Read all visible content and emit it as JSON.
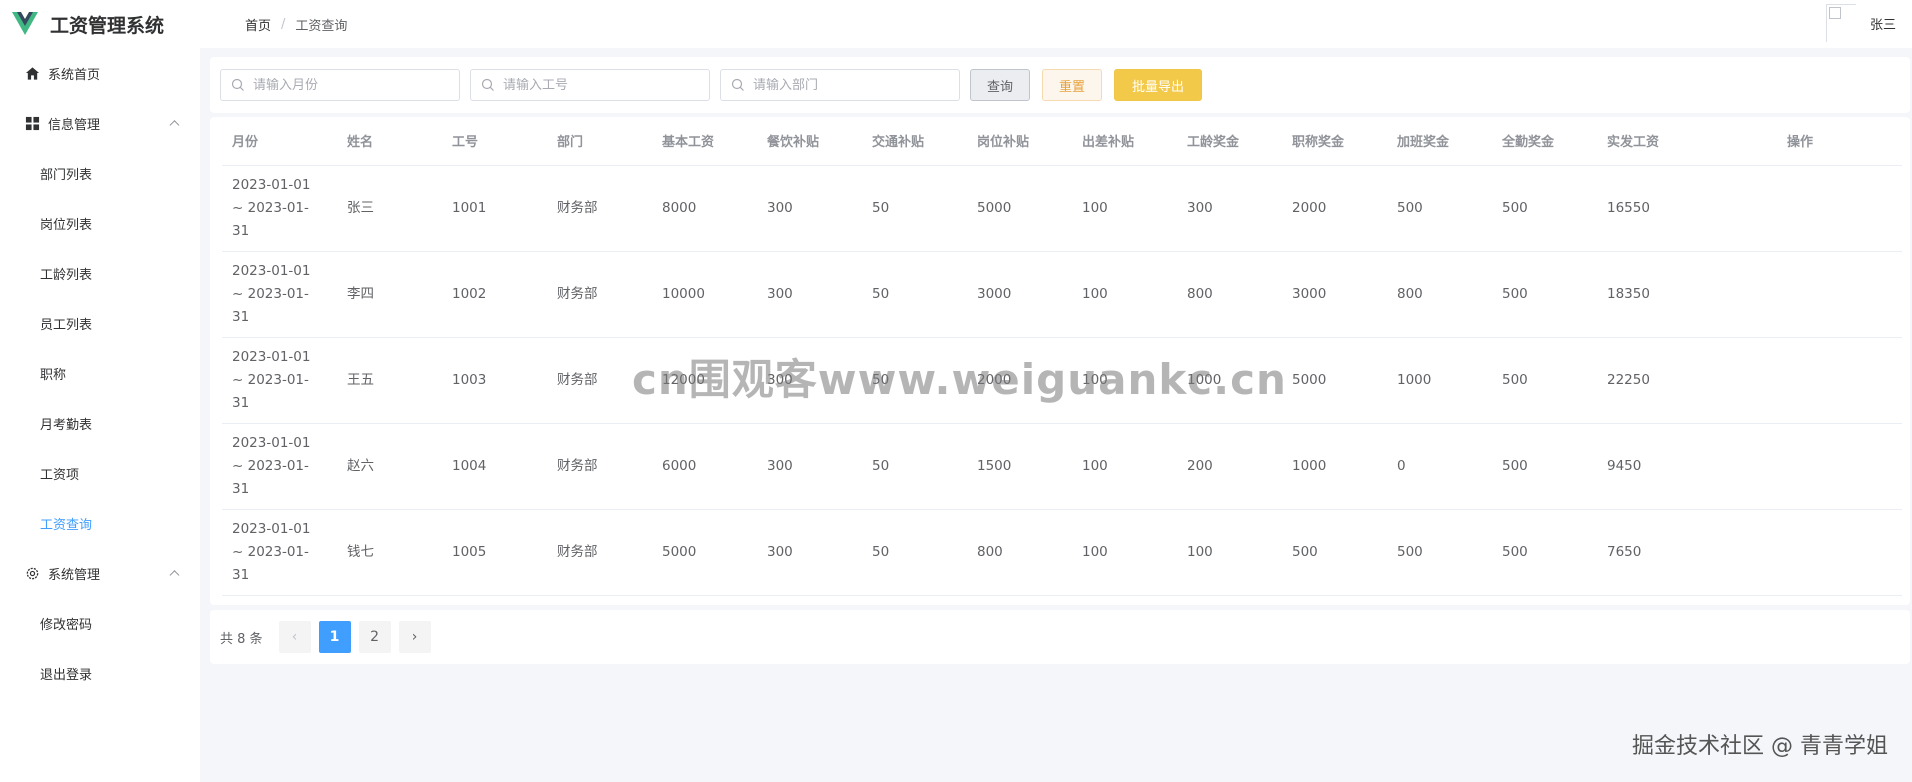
{
  "app": {
    "title": "工资管理系统",
    "brand_color": "#41b883"
  },
  "breadcrumb": {
    "home": "首页",
    "separator": "/",
    "current": "工资查询"
  },
  "user": {
    "name": "张三"
  },
  "sidebar": {
    "items": [
      {
        "label": "系统首页",
        "icon": "home-icon"
      },
      {
        "label": "信息管理",
        "icon": "grid-icon",
        "expanded": true
      },
      {
        "label": "部门列表"
      },
      {
        "label": "岗位列表"
      },
      {
        "label": "工龄列表"
      },
      {
        "label": "员工列表"
      },
      {
        "label": "职称"
      },
      {
        "label": "月考勤表"
      },
      {
        "label": "工资项"
      },
      {
        "label": "工资查询",
        "active": true
      },
      {
        "label": "系统管理",
        "icon": "gear-icon",
        "expanded": true
      },
      {
        "label": "修改密码"
      },
      {
        "label": "退出登录"
      }
    ]
  },
  "search": {
    "month_placeholder": "请输入月份",
    "id_placeholder": "请输入工号",
    "dept_placeholder": "请输入部门",
    "query_label": "查询",
    "reset_label": "重置",
    "export_label": "批量导出"
  },
  "table": {
    "headers": [
      "月份",
      "姓名",
      "工号",
      "部门",
      "基本工资",
      "餐饮补贴",
      "交通补贴",
      "岗位补贴",
      "出差补贴",
      "工龄奖金",
      "职称奖金",
      "加班奖金",
      "全勤奖金",
      "实发工资",
      "操作"
    ],
    "rows": [
      {
        "month": "2023-01-01 ~ 2023-01-31",
        "name": "张三",
        "id": "1001",
        "dept": "财务部",
        "base": "8000",
        "meal": "300",
        "traffic": "50",
        "post": "5000",
        "trip": "100",
        "seniority": "300",
        "title_bonus": "2000",
        "overtime": "500",
        "attendance": "500",
        "net": "16550"
      },
      {
        "month": "2023-01-01 ~ 2023-01-31",
        "name": "李四",
        "id": "1002",
        "dept": "财务部",
        "base": "10000",
        "meal": "300",
        "traffic": "50",
        "post": "3000",
        "trip": "100",
        "seniority": "800",
        "title_bonus": "3000",
        "overtime": "800",
        "attendance": "500",
        "net": "18350"
      },
      {
        "month": "2023-01-01 ~ 2023-01-31",
        "name": "王五",
        "id": "1003",
        "dept": "财务部",
        "base": "12000",
        "meal": "300",
        "traffic": "50",
        "post": "2000",
        "trip": "100",
        "seniority": "1000",
        "title_bonus": "5000",
        "overtime": "1000",
        "attendance": "500",
        "net": "22250"
      },
      {
        "month": "2023-01-01 ~ 2023-01-31",
        "name": "赵六",
        "id": "1004",
        "dept": "财务部",
        "base": "6000",
        "meal": "300",
        "traffic": "50",
        "post": "1500",
        "trip": "100",
        "seniority": "200",
        "title_bonus": "1000",
        "overtime": "0",
        "attendance": "500",
        "net": "9450"
      },
      {
        "month": "2023-01-01 ~ 2023-01-31",
        "name": "钱七",
        "id": "1005",
        "dept": "财务部",
        "base": "5000",
        "meal": "300",
        "traffic": "50",
        "post": "800",
        "trip": "100",
        "seniority": "100",
        "title_bonus": "500",
        "overtime": "500",
        "attendance": "500",
        "net": "7650"
      }
    ]
  },
  "pagination": {
    "total_label": "共 8 条",
    "pages": [
      "1",
      "2"
    ],
    "current": "1",
    "prev": "‹",
    "next": "›"
  },
  "watermarks": {
    "center": "cn围观客www.weiguankc.cn",
    "corner": "掘金技术社区 @ 青青学姐"
  }
}
